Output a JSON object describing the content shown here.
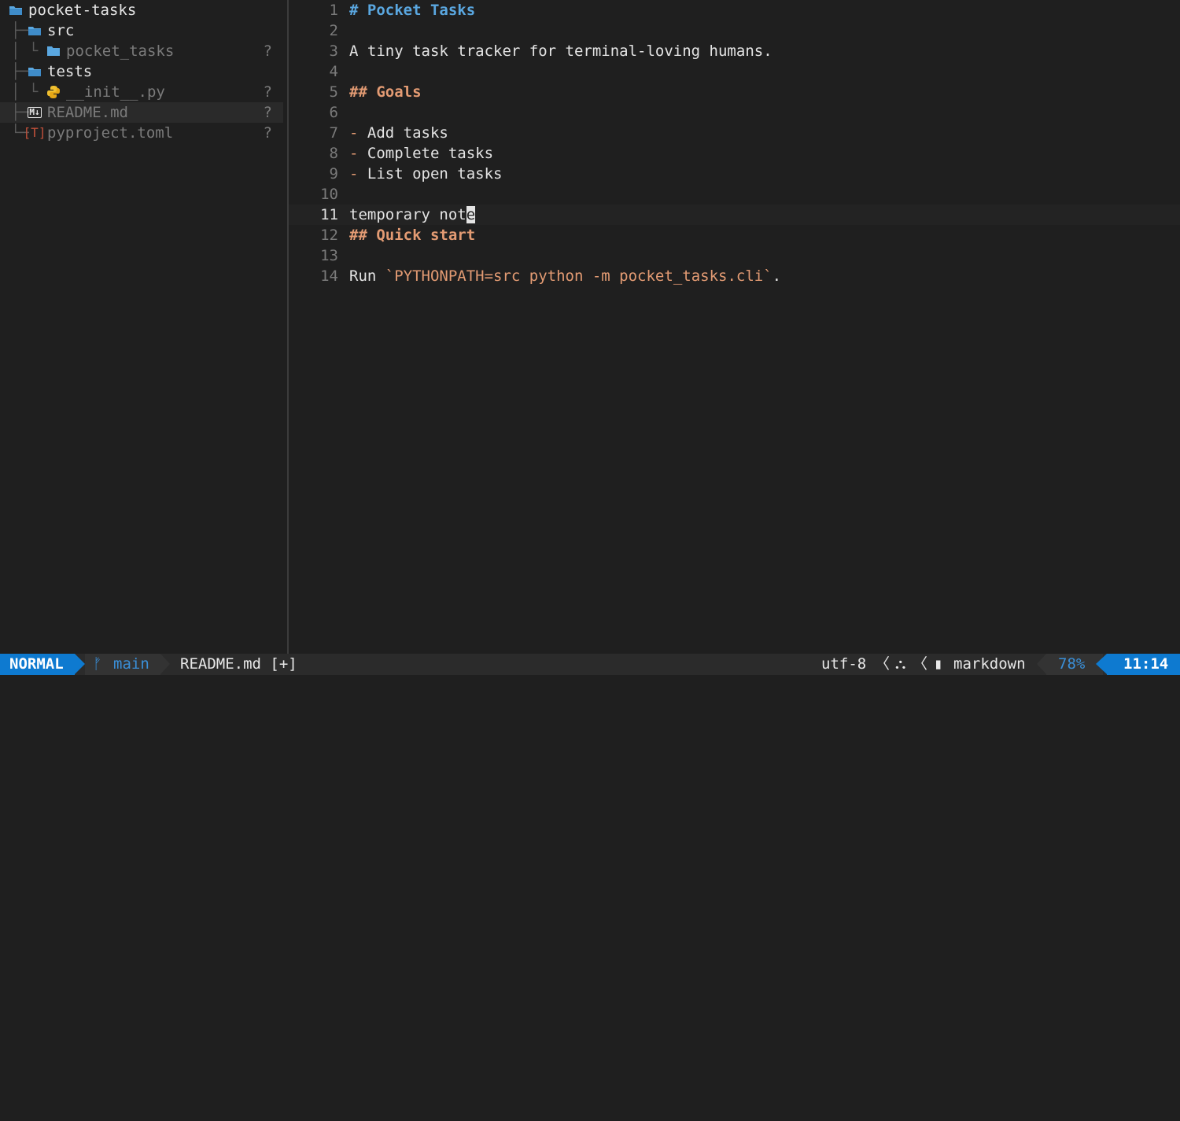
{
  "tree": {
    "root": {
      "name": "pocket-tasks",
      "icon": "folder-open-icon"
    },
    "items": [
      {
        "name": "src",
        "icon": "folder-open-icon",
        "status": ""
      },
      {
        "name": "pocket_tasks",
        "icon": "folder-icon",
        "status": "?"
      },
      {
        "name": "tests",
        "icon": "folder-open-icon",
        "status": ""
      },
      {
        "name": "__init__.py",
        "icon": "python-icon",
        "status": "?"
      },
      {
        "name": "README.md",
        "icon": "markdown-icon",
        "status": "?"
      },
      {
        "name": "pyproject.toml",
        "icon": "toml-icon",
        "status": "?"
      }
    ],
    "icon_glyphs": {
      "toml": "[T]",
      "markdown": "M↓"
    }
  },
  "editor": {
    "lines": [
      {
        "num": "1",
        "parts": [
          {
            "t": "# Pocket Tasks",
            "c": "h1"
          }
        ]
      },
      {
        "num": "2",
        "parts": []
      },
      {
        "num": "3",
        "parts": [
          {
            "t": "A tiny task tracker for terminal-loving humans.",
            "c": ""
          }
        ]
      },
      {
        "num": "4",
        "parts": []
      },
      {
        "num": "5",
        "parts": [
          {
            "t": "## Goals",
            "c": "h2"
          }
        ]
      },
      {
        "num": "6",
        "parts": []
      },
      {
        "num": "7",
        "parts": [
          {
            "t": "-",
            "c": "bullet"
          },
          {
            "t": " Add tasks",
            "c": ""
          }
        ]
      },
      {
        "num": "8",
        "parts": [
          {
            "t": "-",
            "c": "bullet"
          },
          {
            "t": " Complete tasks",
            "c": ""
          }
        ]
      },
      {
        "num": "9",
        "parts": [
          {
            "t": "-",
            "c": "bullet"
          },
          {
            "t": " List open tasks",
            "c": ""
          }
        ]
      },
      {
        "num": "10",
        "parts": []
      },
      {
        "num": "11",
        "parts": [
          {
            "t": "temporary not",
            "c": ""
          },
          {
            "t": "e",
            "c": "cursor"
          }
        ]
      },
      {
        "num": "12",
        "parts": [
          {
            "t": "## Quick start",
            "c": "h2"
          }
        ]
      },
      {
        "num": "13",
        "parts": []
      },
      {
        "num": "14",
        "parts": [
          {
            "t": "Run ",
            "c": ""
          },
          {
            "t": "`PYTHONPATH=src python -m pocket_tasks.cli`",
            "c": "code"
          },
          {
            "t": ".",
            "c": ""
          }
        ]
      }
    ],
    "current_line": "11"
  },
  "statusline": {
    "mode": "NORMAL",
    "branch_icon": "ᚠ",
    "branch": "main",
    "file": "README.md [+]",
    "encoding": "utf-8",
    "separator": "〈",
    "os_icon": "linux-icon",
    "os_glyph": "⛬",
    "filetype_icon": "file-icon",
    "filetype_glyph": "▮",
    "filetype": "markdown",
    "percent": "78%",
    "position": "11:14"
  },
  "colors": {
    "accent": "#0e7ad0",
    "folder": "#5aa7e0",
    "heading1": "#5aa7e0",
    "heading2": "#e39b73",
    "python": "#f0c030",
    "toml": "#c0503a"
  }
}
